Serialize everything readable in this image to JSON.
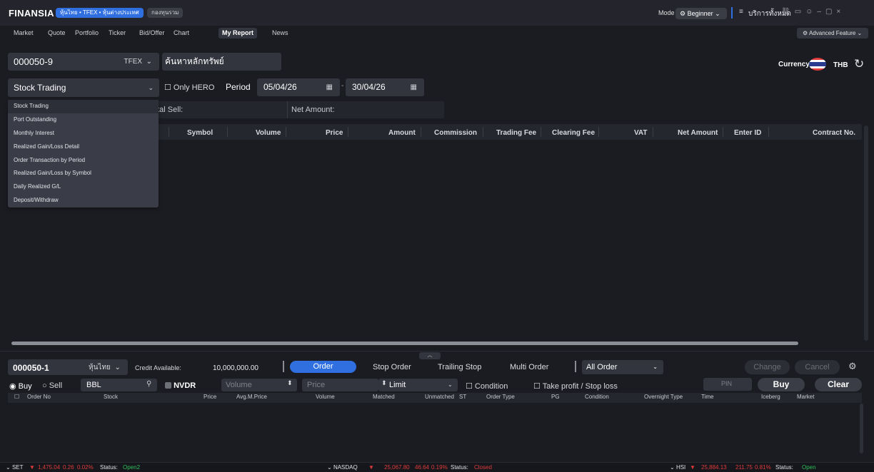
{
  "titlebar": {
    "logo": "FINANSIA",
    "market_pill": "หุ้นไทย • TFEX • หุ้นต่างประเทศ",
    "fund_pill": "กองทุนรวม",
    "mode_label": "Mode",
    "mode_value": "Beginner",
    "all_services": "บริการทั้งหมด"
  },
  "nav": {
    "tabs": [
      "Market",
      "Quote",
      "Portfolio",
      "Ticker",
      "Bid/Offer",
      "Chart",
      "My Report",
      "News"
    ],
    "active": "My Report",
    "advanced": "Advanced Feature"
  },
  "report": {
    "account": "000050-9",
    "account_market": "TFEX",
    "search_placeholder": "ค้นหาหลักทรัพย์",
    "currency_label": "Currency:",
    "currency_code": "THB",
    "report_type": "Stock Trading",
    "only_hero": "Only HERO",
    "period_label": "Period",
    "date_from": "05/04/26",
    "date_to": "30/04/26",
    "date_sep": "-",
    "total_sell": "otal Sell:",
    "net_amount": "Net Amount:",
    "columns": [
      "Symbol",
      "Volume",
      "Price",
      "Amount",
      "Commission",
      "Trading Fee",
      "Clearing Fee",
      "VAT",
      "Net Amount",
      "Enter ID",
      "Contract No."
    ],
    "dropdown_items": [
      "Stock Trading",
      "Port Outstanding",
      "Monthly Interest",
      "Realized Gain/Loss Detail",
      "Order Transaction by Period",
      "Realized Gain/Loss by Symbol",
      "Daily Realized G/L",
      "Deposit/Withdraw"
    ]
  },
  "order": {
    "account": "000050-1",
    "account_market": "หุ้นไทย",
    "credit_label": "Credit Available:",
    "credit_value": "10,000,000.00",
    "tabs": [
      "Order",
      "Stop Order",
      "Trailing Stop",
      "Multi Order"
    ],
    "filter": "All Order",
    "change": "Change",
    "cancel": "Cancel",
    "buy_label": "Buy",
    "sell_label": "Sell",
    "stock": "BBL",
    "nvdr": "NVDR",
    "volume_placeholder": "Volume",
    "price_placeholder": "Price",
    "price_type": "Limit",
    "condition": "Condition",
    "take_profit": "Take profit / Stop loss",
    "pin_placeholder": "PIN",
    "buy_button": "Buy",
    "clear_button": "Clear",
    "columns": [
      "Order No",
      "Stock",
      "Price",
      "Avg.M.Price",
      "Volume",
      "Matched",
      "Unmatched",
      "ST",
      "Order Type",
      "PG",
      "Condition",
      "Overnight Type",
      "Time",
      "Iceberg",
      "Market"
    ]
  },
  "statusbar": {
    "set": {
      "name": "SET",
      "value": "1,475.04",
      "change": "0.26",
      "pct": "0.02%",
      "status_label": "Status:",
      "status": "Open2"
    },
    "nasdaq": {
      "name": "NASDAQ",
      "value": "25,067.80",
      "change": "46.64",
      "pct": "0.19%",
      "status_label": "Status:",
      "status": "Closed"
    },
    "hsi": {
      "name": "HSI",
      "value": "25,884.13",
      "change": "211.75",
      "pct": "0.81%",
      "status_label": "Status:",
      "status": "Open"
    }
  },
  "colors": {
    "accent": "#2f6fe0",
    "down": "#e03a3a",
    "up": "#2fbf5a",
    "panel": "#33353e",
    "background": "#1b1c22"
  }
}
